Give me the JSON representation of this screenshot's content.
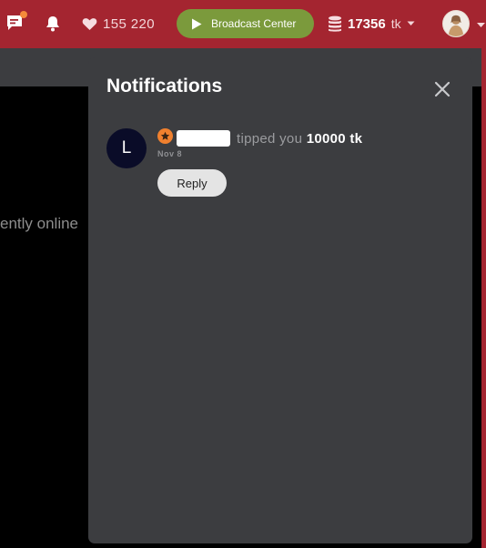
{
  "topbar": {
    "likes_count": "155 220",
    "broadcast_label": "Broadcast Center",
    "tokens_amount": "17356",
    "tokens_unit": "tk",
    "icons": [
      "chat-icon",
      "bell-icon",
      "heart-icon",
      "play-icon",
      "coins-icon",
      "chevron-down-icon"
    ]
  },
  "background": {
    "side_text": "ently online"
  },
  "notifications": {
    "title": "Notifications",
    "items": [
      {
        "message": "tipped you",
        "amount": "10000 tk",
        "date": "Nov 8",
        "avatar_letter": "L",
        "reply_label": "Reply"
      }
    ]
  },
  "colors": {
    "topbar": "#A42530",
    "broadcast_button": "#7B9A3C",
    "panel": "#3C3D40",
    "badge": "#F0802E"
  }
}
